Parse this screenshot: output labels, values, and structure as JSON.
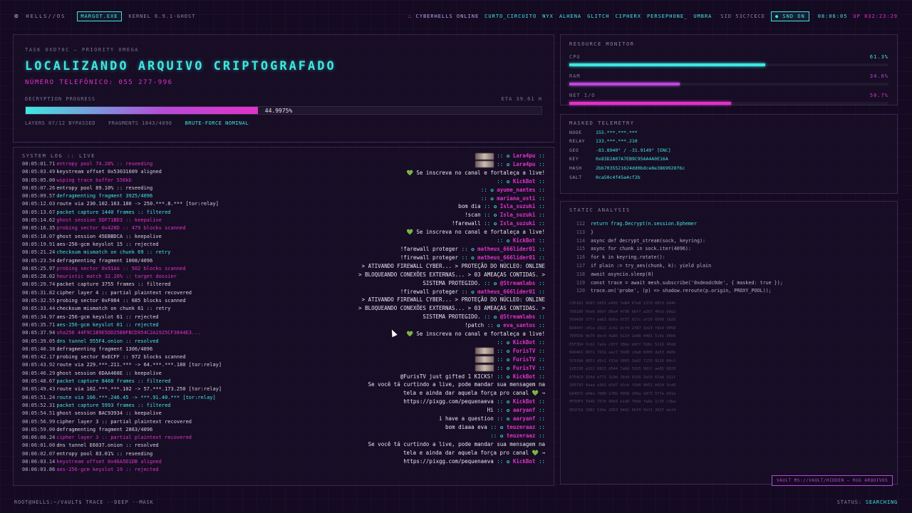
{
  "topbar": {
    "os_name": "HELLS//OS",
    "process": "MARGOT.EXE",
    "kernel": "KERNEL 6.9.1-GHOST",
    "online_label": "CYBERHELLS ONLINE",
    "users": [
      "CURTO_CIRCUITO",
      "NYX",
      "ALHENA",
      "GLITCH",
      "CIPHERX",
      "PERSEPHONE_",
      "UMBRA"
    ],
    "sid": "SID 53C7CECE",
    "snd": "SND ON",
    "clock": "08:06:05",
    "uptime": "UP 032:23:29"
  },
  "task": {
    "id": "TASK 0XD70C — PRIORITY OMEGA",
    "title": "LOCALIZANDO ARQUIVO CRIPTOGRAFADO",
    "phone": "NÚMERO TELEFÔNICO: 055 277-996",
    "progress_label": "DECRYPTION PROGRESS",
    "eta": "ETA 39.61 H",
    "progress": 0.449975,
    "progress_text": "44.9975%",
    "layers": "LAYERS 07/12 BYPASSED",
    "fragments": "FRAGMENTS 1843/4096",
    "bruteforce": "BRUTE-FORCE NOMINAL"
  },
  "log": {
    "title": "SYSTEM LOG :: LIVE",
    "lines": [
      {
        "ts": "08:05:01.71",
        "msg": "entropy pool 74.28% :: reseeding",
        "c": "pink"
      },
      {
        "ts": "08:05:03.49",
        "msg": "keystream offset 0x53031609 aligned",
        "c": "white"
      },
      {
        "ts": "08:05:05.00",
        "msg": "wiping trace buffer 556kb",
        "c": "pink"
      },
      {
        "ts": "08:05:07.26",
        "msg": "entropy pool 89.10% :: reseeding",
        "c": "white"
      },
      {
        "ts": "08:05:09.57",
        "msg": "defragmenting fragment 3925/4096",
        "c": "cyan"
      },
      {
        "ts": "08:05:12.03",
        "msg": "route via 230.102.163.180 -> 250.***.8.*** [tor:relay]",
        "c": "white"
      },
      {
        "ts": "08:05:13.67",
        "msg": "packet capture 1440 frames :: filtered",
        "c": "cyan"
      },
      {
        "ts": "08:05:14.62",
        "msg": "ghost session 5DF71BD3 :: keepalive",
        "c": "pink"
      },
      {
        "ts": "08:05:16.35",
        "msg": "probing sector 0x428D :: 479 blocks scanned",
        "c": "pink"
      },
      {
        "ts": "08:05:18.07",
        "msg": "ghost session 45EBBDCA :: keepalive",
        "c": "white"
      },
      {
        "ts": "08:05:19.91",
        "msg": "aes-256-gcm keyslot 15 :: rejected",
        "c": "white"
      },
      {
        "ts": "08:05:21.24",
        "msg": "checksum mismatch on chunk 69 :: retry",
        "c": "cyan"
      },
      {
        "ts": "08:05:23.54",
        "msg": "defragmenting fragment 1008/4096",
        "c": "white"
      },
      {
        "ts": "08:05:25.97",
        "msg": "probing sector 0x91AA :: 502 blocks scanned",
        "c": "pink"
      },
      {
        "ts": "08:05:28.02",
        "msg": "heuristic match 32.20% :: target dossier",
        "c": "pink"
      },
      {
        "ts": "08:05:29.74",
        "msg": "packet capture 3755 frames :: filtered",
        "c": "white"
      },
      {
        "ts": "08:05:31.82",
        "msg": "cipher layer 4 :: partial plaintext recovered",
        "c": "white"
      },
      {
        "ts": "08:05:32.55",
        "msg": "probing sector 0xF084 :: 685 blocks scanned",
        "c": "white"
      },
      {
        "ts": "08:05:33.44",
        "msg": "checksum mismatch on chunk 61 :: retry",
        "c": "white"
      },
      {
        "ts": "08:05:34.97",
        "msg": "aes-256-gcm keyslot 61 :: rejected",
        "c": "white"
      },
      {
        "ts": "08:05:35.71",
        "msg": "aes-256-gcm keyslot 01 :: rejected",
        "c": "cyan"
      },
      {
        "ts": "08:05:37.94",
        "msg": "sha256 44F9C1B9E5DD25B8FBCD954C2A1925CF3844E3...",
        "c": "pink"
      },
      {
        "ts": "08:05:39.05",
        "msg": "dns tunnel 955F4.onion :: resolved",
        "c": "cyan"
      },
      {
        "ts": "08:05:40.38",
        "msg": "defragmenting fragment 1306/4096",
        "c": "white"
      },
      {
        "ts": "08:05:42.17",
        "msg": "probing sector 0xECFF :: 972 blocks scanned",
        "c": "white"
      },
      {
        "ts": "08:05:43.92",
        "msg": "route via 229.***.211.*** -> 64.***.***.180 [tor:relay]",
        "c": "white"
      },
      {
        "ts": "08:05:46.29",
        "msg": "ghost session 6DAA468E :: keepalive",
        "c": "white"
      },
      {
        "ts": "08:05:48.67",
        "msg": "packet capture 8468 frames :: filtered",
        "c": "cyan"
      },
      {
        "ts": "08:05:49.43",
        "msg": "route via 102.***.***.102 -> 57.***.173.250 [tor:relay]",
        "c": "white"
      },
      {
        "ts": "08:05:51.24",
        "msg": "route via 166.***.246.45 -> ***.91.40.*** [tor:relay]",
        "c": "cyan"
      },
      {
        "ts": "08:05:52.31",
        "msg": "packet capture 5993 frames :: filtered",
        "c": "cyan"
      },
      {
        "ts": "08:05:54.51",
        "msg": "ghost session BAC93934 :: keepalive",
        "c": "white"
      },
      {
        "ts": "08:05:56.99",
        "msg": "cipher layer 3 :: partial plaintext recovered",
        "c": "white"
      },
      {
        "ts": "08:05:59.00",
        "msg": "defragmenting fragment 2863/4096",
        "c": "white"
      },
      {
        "ts": "08:06:00.24",
        "msg": "cipher layer 3 :: partial plaintext recovered",
        "c": "pink"
      },
      {
        "ts": "08:06:01.00",
        "msg": "dns tunnel E6037.onion :: resolved",
        "c": "white"
      },
      {
        "ts": "08:06:02.07",
        "msg": "entropy pool 83.01% :: reseeding",
        "c": "white"
      },
      {
        "ts": "08:06:03.14",
        "msg": "keystream offset 0x46A5D1DB aligned",
        "c": "pink"
      },
      {
        "ts": "08:06:03.86",
        "msg": "aes-256-gcm keyslot 19 :: rejected",
        "c": "pink"
      }
    ]
  },
  "chat": [
    {
      "text": "",
      "user": "Lara4pu",
      "avatar": true
    },
    {
      "text": "",
      "user": "Lara4pu",
      "avatar": true
    },
    {
      "text": "Se inscreva no canal e fortaleça a live!",
      "user": "",
      "heart": true
    },
    {
      "text": "",
      "user": "KickBot"
    },
    {
      "text": "",
      "user": "ayume_nantes"
    },
    {
      "text": "",
      "user": "mariana_osti"
    },
    {
      "text": "bom dia",
      "user": "Isla_suzuki"
    },
    {
      "text": "!scan",
      "user": "Isla_suzuki"
    },
    {
      "text": "!farewall",
      "user": "Isla_suzuki"
    },
    {
      "text": "Se inscreva no canal e fortaleça a live!",
      "user": "",
      "heart": true
    },
    {
      "text": "",
      "user": "KickBot"
    },
    {
      "text": "!farewall proteger",
      "user": "matheus_666lider01"
    },
    {
      "text": "!firewall proteger",
      "user": "matheus_666lider01"
    },
    {
      "text": "> ATIVANDO FIREWALL CYBER... > PROTEÇÃO DO NÚCLEO: ONLINE",
      "user": ""
    },
    {
      "text": "> BLOQUEANDO CONEXÕES EXTERNAS... > 03 AMEAÇAS CONTIDAS. >",
      "user": ""
    },
    {
      "text": "SISTEMA PROTEGIDO.",
      "user": "@Streamlabs"
    },
    {
      "text": "!firewall proteger",
      "user": "matheus_666lider01"
    },
    {
      "text": "> ATIVANDO FIREWALL CYBER... > PROTEÇÃO DO NÚCLEO: ONLINE",
      "user": ""
    },
    {
      "text": "> BLOQUEANDO CONEXÕES EXTERNAS... > 03 AMEAÇAS CONTIDAS. >",
      "user": ""
    },
    {
      "text": "SISTEMA PROTEGIDO.",
      "user": "@Streamlabs"
    },
    {
      "text": "!patch",
      "user": "eva_santos"
    },
    {
      "text": "Se inscreva no canal e fortaleça a live!",
      "user": "",
      "heart": true
    },
    {
      "text": "",
      "user": "KickBot"
    },
    {
      "text": "",
      "user": "FurisTV",
      "avatar": true
    },
    {
      "text": "",
      "user": "FurisTV",
      "avatar": true
    },
    {
      "text": "",
      "user": "FurisTV",
      "avatar": true
    },
    {
      "text": "@FurisTV just gifted 1 KICKS!",
      "user": "KickBot"
    },
    {
      "text": "Se você tá curtindo a live, pode mandar sua mensagem na",
      "user": ""
    },
    {
      "text": "tela e ainda dar aquela força pro canal 💚 →",
      "user": ""
    },
    {
      "text": "https://pixgg.com/pequenaeva",
      "user": "KickBot"
    },
    {
      "text": "Hi",
      "user": "aaryanf"
    },
    {
      "text": "i have a question",
      "user": "aaryanf"
    },
    {
      "text": "bom diaaa eva",
      "user": "teuzeraaz"
    },
    {
      "text": "",
      "user": "teuzeraaz"
    },
    {
      "text": "Se você tá curtindo a live, pode mandar sua mensagem na",
      "user": ""
    },
    {
      "text": "tela e ainda dar aquela força pro canal 💚 →",
      "user": ""
    },
    {
      "text": "https://pixgg.com/pequenaeva",
      "user": "KickBot"
    }
  ],
  "resources": {
    "title": "RESOURCE MONITOR",
    "items": [
      {
        "label": "CPU",
        "value": 0.613,
        "text": "61.3%",
        "color": "#3de8e0"
      },
      {
        "label": "RAM",
        "value": 0.346,
        "text": "34.6%",
        "color": "#b84ad8"
      },
      {
        "label": "NET I/O",
        "value": 0.507,
        "text": "50.7%",
        "color": "#e033c8"
      }
    ]
  },
  "telemetry": {
    "title": "MASKED TELEMETRY",
    "rows": [
      {
        "k": "NODE",
        "v": "155.***.***.***"
      },
      {
        "k": "RELAY",
        "v": "133.***.***.210"
      },
      {
        "k": "GEO",
        "v": "-83.8940° / -31.9149° [ENC]"
      },
      {
        "k": "KEY",
        "v": "0x83D2A07A7EB9C95AA4A0E16A"
      },
      {
        "k": "HASH",
        "v": "2bb7035521624dd0bdce8e3869928f6c"
      },
      {
        "k": "SALT",
        "v": "0ca50c4f45a4cf2b"
      }
    ]
  },
  "static_analysis": {
    "title": "STATIC ANALYSIS",
    "code": [
      {
        "n": "112",
        "src": "return frag.Decrypt(n.session.Ephemer",
        "hl": true
      },
      {
        "n": "113",
        "src": "}"
      },
      {
        "n": "114",
        "src": "async def decrypt_stream(sock, keyring):"
      },
      {
        "n": "115",
        "src": "async for chunk in sock.iter(4096):"
      },
      {
        "n": "116",
        "src": "for k in keyring.rotate():"
      },
      {
        "n": "117",
        "src": "if plain := try_aes(chunk, k): yield plain"
      },
      {
        "n": "118",
        "src": "await asyncio.sleep(0)"
      },
      {
        "n": "119",
        "src": "const trace = await mesh.subscribe('0xdeadc0de', { masked: true });"
      },
      {
        "n": "120",
        "src": "trace.on('probe', (p) => shadow.reroute(p.origin, PROXY_POOL));"
      }
    ],
    "hex": [
      "C95181 9d97 b653 e492 fa84 6fa0 1379 087d d44b",
      "788180 65e6 d0bf 80a4 4796 9bff a267 40cb b0a2",
      "569430 37ff aa63 8b6a d737 617c af39 0998 1b20",
      "B3444f c01a 2622 2c42 dcf4 2f87 1b24 f8e9 9058",
      "7E093A 9b70 dec0 4a66 6114 2e88 4401 5c6e 96b6",
      "E5F3D4 3cd2 fa2e c9ff 18be ddff 516c 5216 43dd",
      "0AD461 9071 7632 aac7 5b08 cda8 6003 da53 db0b",
      "5C018A 0651 d5c2 f52d 3805 3dd2 7135 9226 80c1",
      "12E23D e322 6823 d544 7a0d 5265 901f ae02 8820",
      "6754C8 334d e771 329d 16d4 9155 3a39 67a8 311f",
      "205792 4aaa a362 d3d7 d1cb f2b6 0b51 b024 3cd0",
      "6A4D72 d4da 7080 176b 0058 166a b873 57fe d31a",
      "0F30F3 7046 757b 90e5 e1d0 f0e0 fa8e 1c35 c3ba",
      "062C5A 2082 534e 2653 9491 66f0 5bf1 3937 def4"
    ]
  },
  "vault": "VAULT MS://VAULT/HIDDEN — RGG ARQUIVOS",
  "bottombar": {
    "prompt": "ROOT@HELLS:~/VAULT$ TRACE --DEEP --MASK",
    "status_label": "STATUS:",
    "status_value": "SEARCHING"
  }
}
